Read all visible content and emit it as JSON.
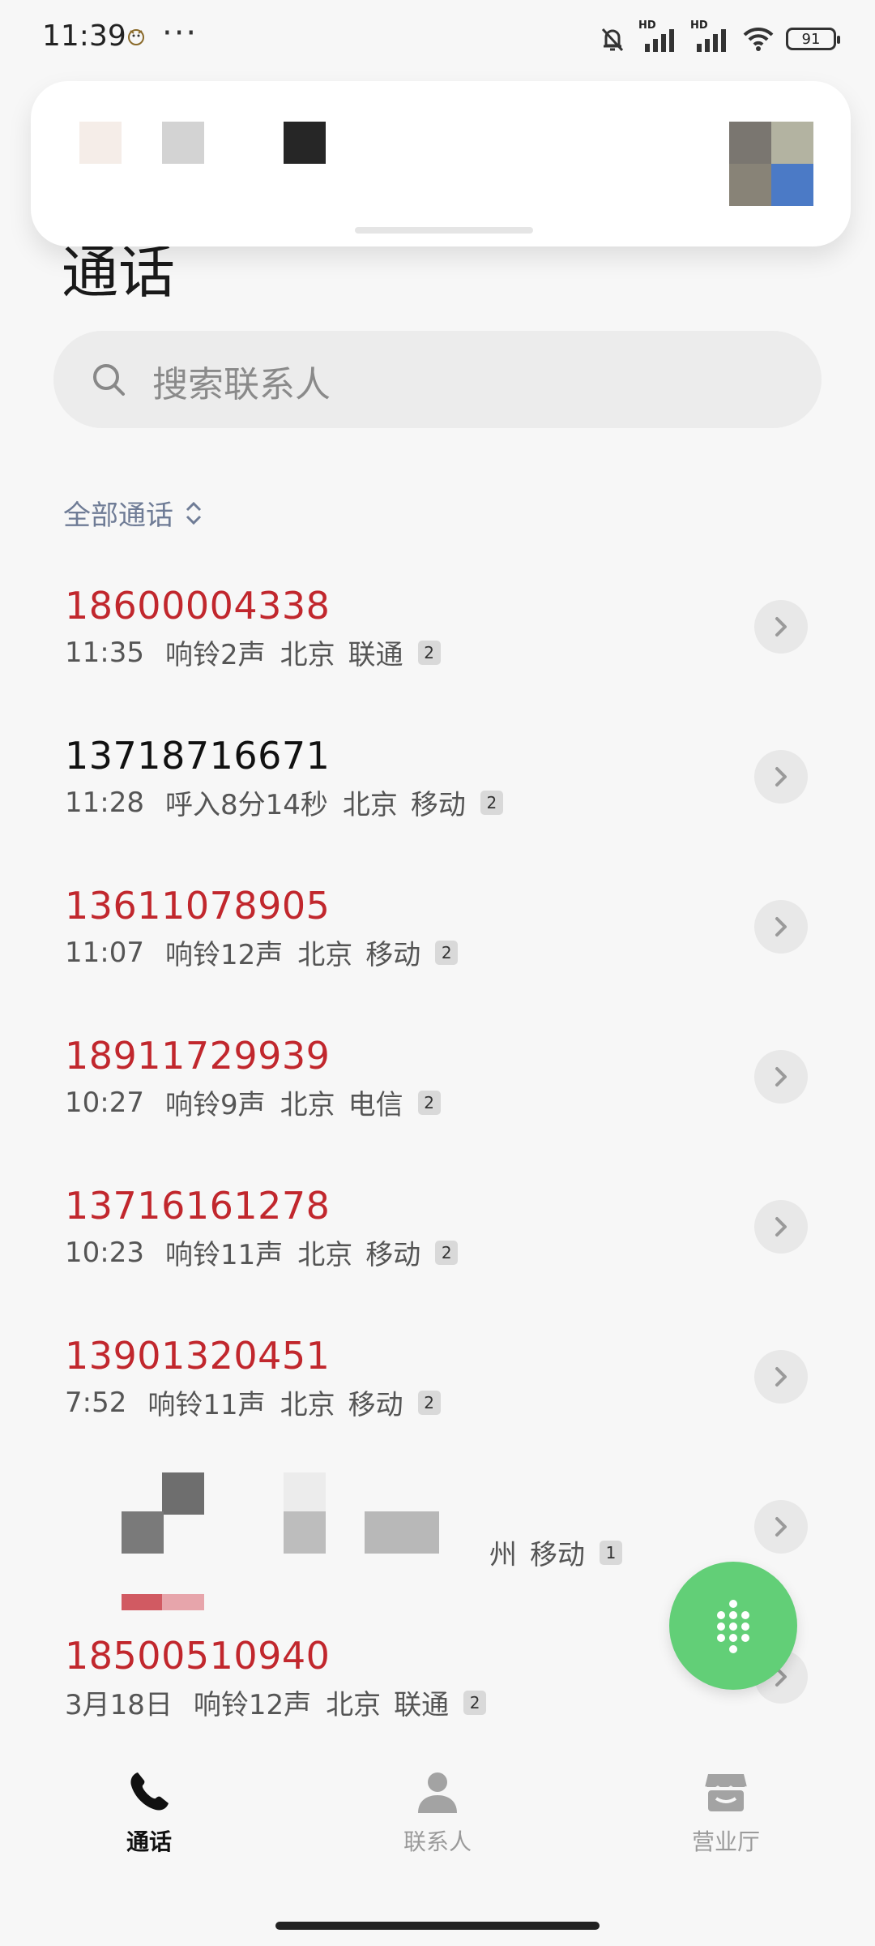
{
  "status_bar": {
    "time": "11:39",
    "more": "···",
    "signal_1_label": "HD",
    "signal_2_label": "HD",
    "battery": "91"
  },
  "header": {
    "title": "通话"
  },
  "search": {
    "placeholder": "搜索联系人"
  },
  "filter": {
    "label": "全部通话"
  },
  "calls": [
    {
      "number": "18600004338",
      "time": "11:35",
      "status": "响铃2声",
      "city": "北京",
      "carrier": "联通",
      "sim": "2",
      "missed": true
    },
    {
      "number": "13718716671",
      "time": "11:28",
      "status": "呼入8分14秒",
      "city": "北京",
      "carrier": "移动",
      "sim": "2",
      "missed": false
    },
    {
      "number": "13611078905",
      "time": "11:07",
      "status": "响铃12声",
      "city": "北京",
      "carrier": "移动",
      "sim": "2",
      "missed": true
    },
    {
      "number": "18911729939",
      "time": "10:27",
      "status": "响铃9声",
      "city": "北京",
      "carrier": "电信",
      "sim": "2",
      "missed": true
    },
    {
      "number": "13716161278",
      "time": "10:23",
      "status": "响铃11声",
      "city": "北京",
      "carrier": "移动",
      "sim": "2",
      "missed": true
    },
    {
      "number": "13901320451",
      "time": "7:52",
      "status": "响铃11声",
      "city": "北京",
      "carrier": "移动",
      "sim": "2",
      "missed": true
    },
    {
      "number": "",
      "time": "",
      "status": "",
      "city": "州",
      "carrier": "移动",
      "sim": "1",
      "missed": false
    },
    {
      "number": "18500510940",
      "time": "3月18日",
      "status": "响铃12声",
      "city": "北京",
      "carrier": "联通",
      "sim": "2",
      "missed": true
    }
  ],
  "bottom_nav": {
    "calls": "通话",
    "contacts": "联系人",
    "hall": "营业厅"
  },
  "colors": {
    "missed": "#c1272d",
    "accent_green": "#62cf77",
    "filter_text": "#6f7c96"
  },
  "icons": {
    "search": "search-icon",
    "chevron": "chevron-right-icon",
    "dialpad": "dialpad-icon",
    "phone": "phone-icon",
    "contact": "person-icon",
    "store": "store-icon"
  }
}
